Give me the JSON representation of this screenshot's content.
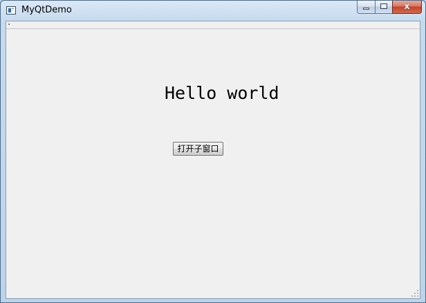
{
  "window": {
    "title": "MyQtDemo",
    "close_glyph": "x",
    "icons": {
      "app": "app-window-icon",
      "minimize": "minimize-icon",
      "maximize": "maximize-icon",
      "close": "close-icon"
    },
    "colors": {
      "frame": "#bcd3ea",
      "client_background": "#f0f0f0",
      "close_button": "#c2432a"
    }
  },
  "content": {
    "label_text": "Hello world",
    "open_child_button": "打开子窗口"
  }
}
